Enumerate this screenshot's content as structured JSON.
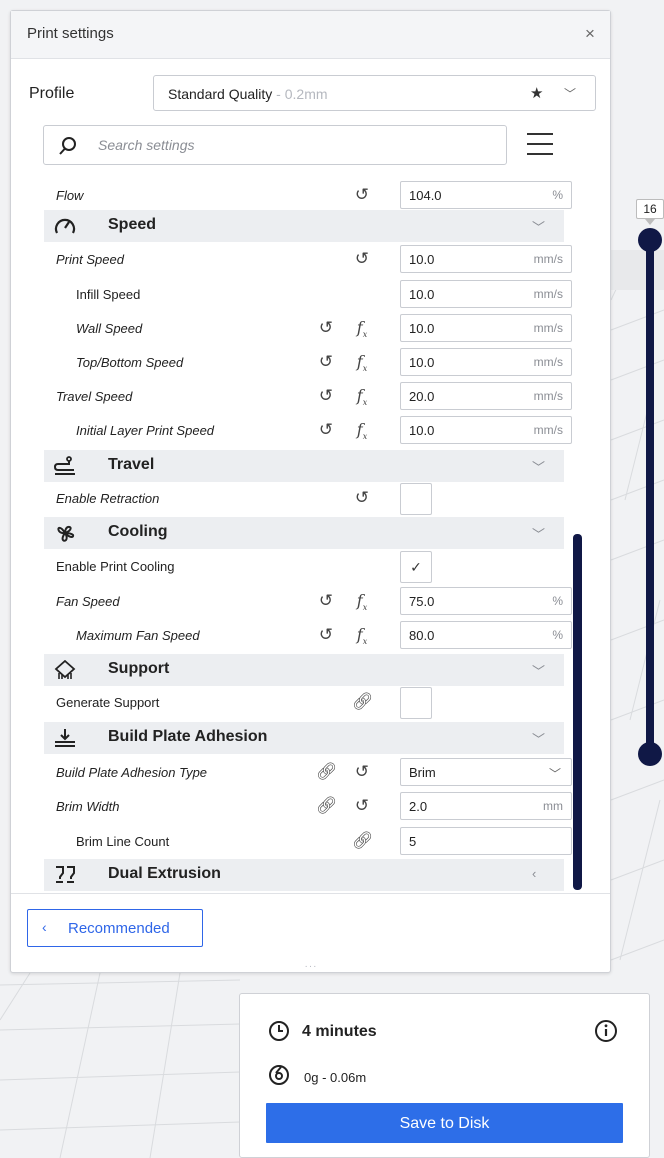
{
  "panel": {
    "title": "Print settings",
    "close": "×",
    "profile_label": "Profile",
    "profile_name": "Standard Quality",
    "profile_sub": " - 0.2mm",
    "search_placeholder": "Search settings",
    "recommended_label": "Recommended"
  },
  "settings": [
    {
      "kind": "row",
      "label": "Flow",
      "italic": true,
      "indent": false,
      "reset": true,
      "fx": false,
      "link": false,
      "value": "104.0",
      "unit": "%"
    },
    {
      "kind": "category",
      "label": "Speed",
      "icon": "speed-icon",
      "chevron": "﹀"
    },
    {
      "kind": "row",
      "label": "Print Speed",
      "italic": true,
      "indent": false,
      "reset": true,
      "fx": false,
      "link": false,
      "value": "10.0",
      "unit": "mm/s"
    },
    {
      "kind": "row",
      "label": "Infill Speed",
      "italic": false,
      "indent": true,
      "reset": false,
      "fx": false,
      "link": false,
      "value": "10.0",
      "unit": "mm/s"
    },
    {
      "kind": "row",
      "label": "Wall Speed",
      "italic": true,
      "indent": true,
      "reset": true,
      "fx": true,
      "link": false,
      "value": "10.0",
      "unit": "mm/s"
    },
    {
      "kind": "row",
      "label": "Top/Bottom Speed",
      "italic": true,
      "indent": true,
      "reset": true,
      "fx": true,
      "link": false,
      "value": "10.0",
      "unit": "mm/s"
    },
    {
      "kind": "row",
      "label": "Travel Speed",
      "italic": true,
      "indent": false,
      "reset": true,
      "fx": true,
      "link": false,
      "value": "20.0",
      "unit": "mm/s"
    },
    {
      "kind": "row",
      "label": "Initial Layer Print Speed",
      "italic": true,
      "indent": true,
      "reset": true,
      "fx": true,
      "link": false,
      "value": "10.0",
      "unit": "mm/s"
    },
    {
      "kind": "category",
      "label": "Travel",
      "icon": "travel-icon",
      "chevron": "﹀"
    },
    {
      "kind": "checkbox",
      "label": "Enable Retraction",
      "italic": true,
      "indent": false,
      "reset": true,
      "fx": false,
      "link": false,
      "checked": false
    },
    {
      "kind": "category",
      "label": "Cooling",
      "icon": "fan-icon",
      "chevron": "﹀"
    },
    {
      "kind": "checkbox",
      "label": "Enable Print Cooling",
      "italic": false,
      "indent": false,
      "reset": false,
      "fx": false,
      "link": false,
      "checked": true
    },
    {
      "kind": "row",
      "label": "Fan Speed",
      "italic": true,
      "indent": false,
      "reset": true,
      "fx": true,
      "link": false,
      "value": "75.0",
      "unit": "%"
    },
    {
      "kind": "row",
      "label": "Maximum Fan Speed",
      "italic": true,
      "indent": true,
      "reset": true,
      "fx": true,
      "link": false,
      "value": "80.0",
      "unit": "%"
    },
    {
      "kind": "category",
      "label": "Support",
      "icon": "support-icon",
      "chevron": "﹀"
    },
    {
      "kind": "checkbox",
      "label": "Generate Support",
      "italic": false,
      "indent": false,
      "reset": false,
      "fx": false,
      "link": true,
      "checked": false
    },
    {
      "kind": "category",
      "label": "Build Plate Adhesion",
      "icon": "adhesion-icon",
      "chevron": "﹀"
    },
    {
      "kind": "dropdown",
      "label": "Build Plate Adhesion Type",
      "italic": true,
      "indent": false,
      "reset": true,
      "fx": false,
      "link": true,
      "value": "Brim"
    },
    {
      "kind": "row",
      "label": "Brim Width",
      "italic": true,
      "indent": false,
      "reset": true,
      "fx": false,
      "link": true,
      "value": "2.0",
      "unit": "mm"
    },
    {
      "kind": "row",
      "label": "Brim Line Count",
      "italic": false,
      "indent": true,
      "reset": false,
      "fx": false,
      "link": true,
      "value": "5",
      "unit": ""
    },
    {
      "kind": "category",
      "label": "Dual Extrusion",
      "icon": "dual-extrusion-icon",
      "chevron": "‹"
    }
  ],
  "layer_slider": {
    "top_label": "16"
  },
  "output": {
    "time": "4 minutes",
    "material": "0g - 0.06m",
    "save_label": "Save to Disk"
  },
  "colors": {
    "accent": "#2d6ee8",
    "slider": "#101846"
  }
}
